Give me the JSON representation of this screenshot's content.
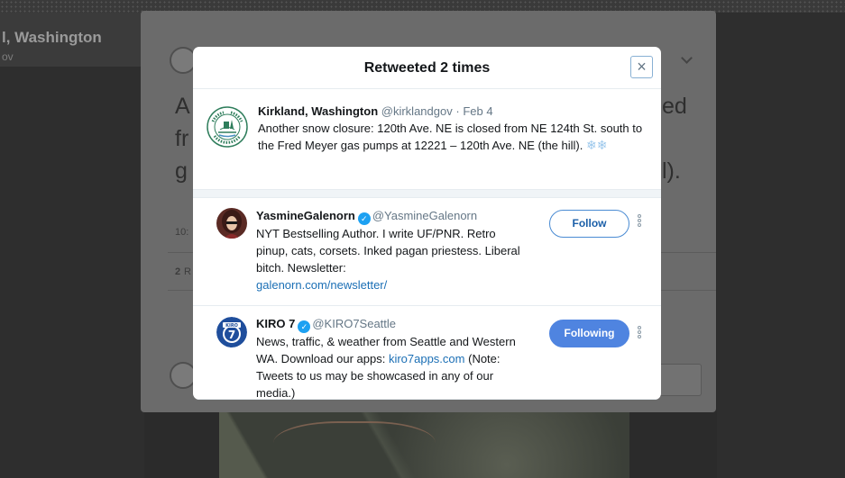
{
  "background": {
    "profile_name": "l, Washington",
    "profile_handle": "ov",
    "tweet_fragments": {
      "a": "A",
      "fr": "fr",
      "g": "g",
      "ed": "ed",
      "paren": "l).",
      "time": "10:",
      "count": "2",
      "count_suffix": "R"
    }
  },
  "modal": {
    "title": "Retweeted 2 times",
    "close_symbol": "×",
    "original_tweet": {
      "author_name": "Kirkland, Washington",
      "author_handle": "@kirklandgov",
      "separator": "·",
      "date": "Feb 4",
      "text": "Another snow closure: 120th Ave. NE is closed from NE 124th St. south to the Fred Meyer gas pumps at 12221 – 120th Ave. NE (the hill).",
      "emoji": "❄❄",
      "avatar_icon": "city-seal-icon"
    },
    "retweeters": [
      {
        "name": "YasmineGalenorn",
        "handle": "@YasmineGalenorn",
        "verified": true,
        "bio": "NYT Bestselling Author. I write UF/PNR. Retro pinup, cats, corsets. Inked pagan priestess. Liberal bitch. Newsletter:",
        "link": "galenorn.com/newsletter/",
        "button_label": "Follow"
      },
      {
        "name": "KIRO 7",
        "handle": "@KIRO7Seattle",
        "verified": true,
        "bio_before_link": "News, traffic, & weather from Seattle and Western WA. Download our apps:",
        "link": "kiro7apps.com",
        "bio_after_link": "(Note: Tweets to us may be showcased in any of our media.)",
        "button_label": "Following",
        "avatar_label": "7"
      }
    ]
  },
  "colors": {
    "accent": "#1da1f2",
    "following_bg": "#4f84e0",
    "link": "#1b6fb5"
  }
}
